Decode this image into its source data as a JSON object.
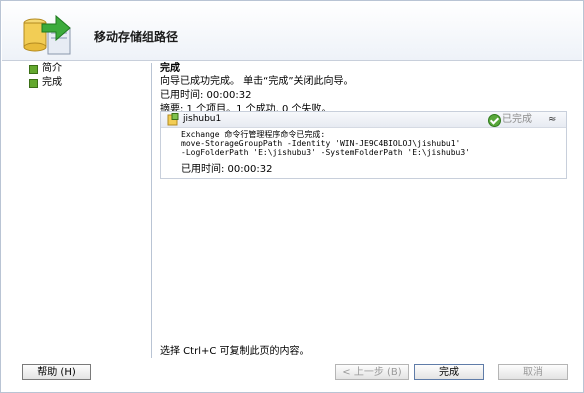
{
  "wizard": {
    "title": "移动存储组路径"
  },
  "steps": [
    {
      "label": "简介"
    },
    {
      "label": "完成"
    }
  ],
  "completion": {
    "heading": "完成",
    "message": "向导已成功完成。 单击“完成”关闭此向导。",
    "elapsed": "已用时间: 00:00:32",
    "summary": "摘要: 1 个项目。1 个成功, 0 个失败。"
  },
  "result": {
    "name": "jishubu1",
    "status": "已完成",
    "collapse_symbol": "≈",
    "body": "Exchange 命令行管理程序命令已完成:\nmove-StorageGroupPath -Identity 'WIN-JE9C4BIOLOJ\\jishubu1'\n-LogFolderPath 'E:\\jishubu3' -SystemFolderPath 'E:\\jishubu3'",
    "elapsed": "已用时间: 00:00:32"
  },
  "hint": "选择 Ctrl+C 可复制此页的内容。",
  "buttons": {
    "help": "帮助 (H)",
    "back": "< 上一步 (B)",
    "finish": "完成",
    "cancel": "取消"
  }
}
